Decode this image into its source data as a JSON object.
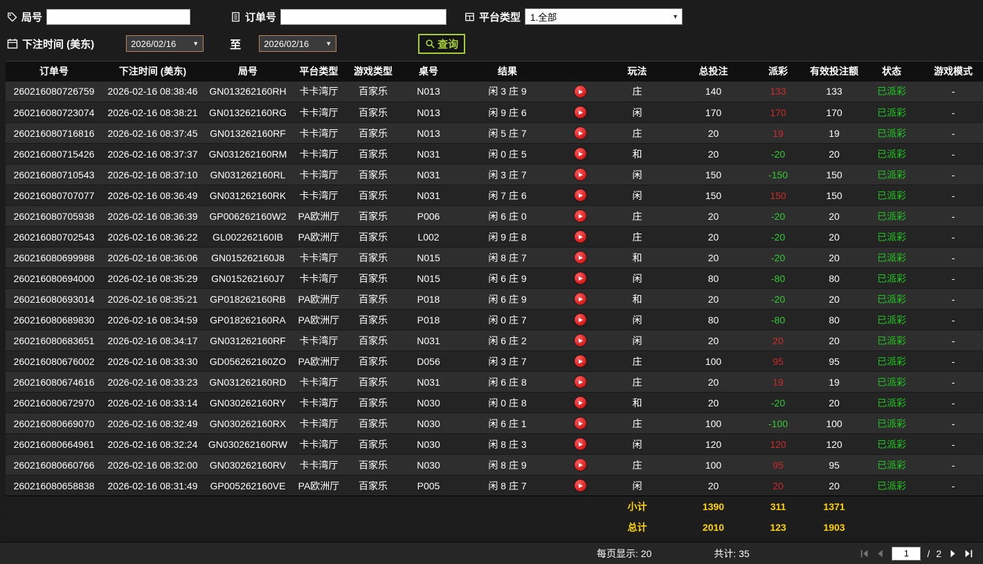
{
  "filters": {
    "game_no_label": "局号",
    "game_no_value": "",
    "order_no_label": "订单号",
    "order_no_value": "",
    "platform_label": "平台类型",
    "platform_value": "1.全部",
    "bet_time_label": "下注时间 (美东)",
    "date_from": "2026/02/16",
    "to_label": "至",
    "date_to": "2026/02/16",
    "query_label": "查询"
  },
  "table": {
    "headers": {
      "order_no": "订单号",
      "bet_time": "下注时间 (美东)",
      "game_no": "局号",
      "platform": "平台类型",
      "game_type": "游戏类型",
      "table_no": "桌号",
      "result": "结果",
      "replay": "",
      "play": "玩法",
      "total_bet": "总投注",
      "payout": "派彩",
      "valid_bet": "有效投注额",
      "status": "状态",
      "mode": "游戏模式"
    },
    "rows": [
      {
        "order_no": "260216080726759",
        "bet_time": "2026-02-16 08:38:46",
        "game_no": "GN013262160RH",
        "platform": "卡卡湾厅",
        "game_type": "百家乐",
        "table_no": "N013",
        "result": "闲 3 庄 9",
        "play": "庄",
        "total_bet": "140",
        "payout": "133",
        "valid_bet": "133",
        "status": "已派彩",
        "mode": "-"
      },
      {
        "order_no": "260216080723074",
        "bet_time": "2026-02-16 08:38:21",
        "game_no": "GN013262160RG",
        "platform": "卡卡湾厅",
        "game_type": "百家乐",
        "table_no": "N013",
        "result": "闲 9 庄 6",
        "play": "闲",
        "total_bet": "170",
        "payout": "170",
        "valid_bet": "170",
        "status": "已派彩",
        "mode": "-"
      },
      {
        "order_no": "260216080716816",
        "bet_time": "2026-02-16 08:37:45",
        "game_no": "GN013262160RF",
        "platform": "卡卡湾厅",
        "game_type": "百家乐",
        "table_no": "N013",
        "result": "闲 5 庄 7",
        "play": "庄",
        "total_bet": "20",
        "payout": "19",
        "valid_bet": "19",
        "status": "已派彩",
        "mode": "-"
      },
      {
        "order_no": "260216080715426",
        "bet_time": "2026-02-16 08:37:37",
        "game_no": "GN031262160RM",
        "platform": "卡卡湾厅",
        "game_type": "百家乐",
        "table_no": "N031",
        "result": "闲 0 庄 5",
        "play": "和",
        "total_bet": "20",
        "payout": "-20",
        "valid_bet": "20",
        "status": "已派彩",
        "mode": "-"
      },
      {
        "order_no": "260216080710543",
        "bet_time": "2026-02-16 08:37:10",
        "game_no": "GN031262160RL",
        "platform": "卡卡湾厅",
        "game_type": "百家乐",
        "table_no": "N031",
        "result": "闲 3 庄 7",
        "play": "闲",
        "total_bet": "150",
        "payout": "-150",
        "valid_bet": "150",
        "status": "已派彩",
        "mode": "-"
      },
      {
        "order_no": "260216080707077",
        "bet_time": "2026-02-16 08:36:49",
        "game_no": "GN031262160RK",
        "platform": "卡卡湾厅",
        "game_type": "百家乐",
        "table_no": "N031",
        "result": "闲 7 庄 6",
        "play": "闲",
        "total_bet": "150",
        "payout": "150",
        "valid_bet": "150",
        "status": "已派彩",
        "mode": "-"
      },
      {
        "order_no": "260216080705938",
        "bet_time": "2026-02-16 08:36:39",
        "game_no": "GP006262160W2",
        "platform": "PA欧洲厅",
        "game_type": "百家乐",
        "table_no": "P006",
        "result": "闲 6 庄 0",
        "play": "庄",
        "total_bet": "20",
        "payout": "-20",
        "valid_bet": "20",
        "status": "已派彩",
        "mode": "-"
      },
      {
        "order_no": "260216080702543",
        "bet_time": "2026-02-16 08:36:22",
        "game_no": "GL002262160IB",
        "platform": "PA欧洲厅",
        "game_type": "百家乐",
        "table_no": "L002",
        "result": "闲 9 庄 8",
        "play": "庄",
        "total_bet": "20",
        "payout": "-20",
        "valid_bet": "20",
        "status": "已派彩",
        "mode": "-"
      },
      {
        "order_no": "260216080699988",
        "bet_time": "2026-02-16 08:36:06",
        "game_no": "GN015262160J8",
        "platform": "卡卡湾厅",
        "game_type": "百家乐",
        "table_no": "N015",
        "result": "闲 8 庄 7",
        "play": "和",
        "total_bet": "20",
        "payout": "-20",
        "valid_bet": "20",
        "status": "已派彩",
        "mode": "-"
      },
      {
        "order_no": "260216080694000",
        "bet_time": "2026-02-16 08:35:29",
        "game_no": "GN015262160J7",
        "platform": "卡卡湾厅",
        "game_type": "百家乐",
        "table_no": "N015",
        "result": "闲 6 庄 9",
        "play": "闲",
        "total_bet": "80",
        "payout": "-80",
        "valid_bet": "80",
        "status": "已派彩",
        "mode": "-"
      },
      {
        "order_no": "260216080693014",
        "bet_time": "2026-02-16 08:35:21",
        "game_no": "GP018262160RB",
        "platform": "PA欧洲厅",
        "game_type": "百家乐",
        "table_no": "P018",
        "result": "闲 6 庄 9",
        "play": "和",
        "total_bet": "20",
        "payout": "-20",
        "valid_bet": "20",
        "status": "已派彩",
        "mode": "-"
      },
      {
        "order_no": "260216080689830",
        "bet_time": "2026-02-16 08:34:59",
        "game_no": "GP018262160RA",
        "platform": "PA欧洲厅",
        "game_type": "百家乐",
        "table_no": "P018",
        "result": "闲 0 庄 7",
        "play": "闲",
        "total_bet": "80",
        "payout": "-80",
        "valid_bet": "80",
        "status": "已派彩",
        "mode": "-"
      },
      {
        "order_no": "260216080683651",
        "bet_time": "2026-02-16 08:34:17",
        "game_no": "GN031262160RF",
        "platform": "卡卡湾厅",
        "game_type": "百家乐",
        "table_no": "N031",
        "result": "闲 6 庄 2",
        "play": "闲",
        "total_bet": "20",
        "payout": "20",
        "valid_bet": "20",
        "status": "已派彩",
        "mode": "-"
      },
      {
        "order_no": "260216080676002",
        "bet_time": "2026-02-16 08:33:30",
        "game_no": "GD056262160ZO",
        "platform": "PA欧洲厅",
        "game_type": "百家乐",
        "table_no": "D056",
        "result": "闲 3 庄 7",
        "play": "庄",
        "total_bet": "100",
        "payout": "95",
        "valid_bet": "95",
        "status": "已派彩",
        "mode": "-"
      },
      {
        "order_no": "260216080674616",
        "bet_time": "2026-02-16 08:33:23",
        "game_no": "GN031262160RD",
        "platform": "卡卡湾厅",
        "game_type": "百家乐",
        "table_no": "N031",
        "result": "闲 6 庄 8",
        "play": "庄",
        "total_bet": "20",
        "payout": "19",
        "valid_bet": "19",
        "status": "已派彩",
        "mode": "-"
      },
      {
        "order_no": "260216080672970",
        "bet_time": "2026-02-16 08:33:14",
        "game_no": "GN030262160RY",
        "platform": "卡卡湾厅",
        "game_type": "百家乐",
        "table_no": "N030",
        "result": "闲 0 庄 8",
        "play": "和",
        "total_bet": "20",
        "payout": "-20",
        "valid_bet": "20",
        "status": "已派彩",
        "mode": "-"
      },
      {
        "order_no": "260216080669070",
        "bet_time": "2026-02-16 08:32:49",
        "game_no": "GN030262160RX",
        "platform": "卡卡湾厅",
        "game_type": "百家乐",
        "table_no": "N030",
        "result": "闲 6 庄 1",
        "play": "庄",
        "total_bet": "100",
        "payout": "-100",
        "valid_bet": "100",
        "status": "已派彩",
        "mode": "-"
      },
      {
        "order_no": "260216080664961",
        "bet_time": "2026-02-16 08:32:24",
        "game_no": "GN030262160RW",
        "platform": "卡卡湾厅",
        "game_type": "百家乐",
        "table_no": "N030",
        "result": "闲 8 庄 3",
        "play": "闲",
        "total_bet": "120",
        "payout": "120",
        "valid_bet": "120",
        "status": "已派彩",
        "mode": "-"
      },
      {
        "order_no": "260216080660766",
        "bet_time": "2026-02-16 08:32:00",
        "game_no": "GN030262160RV",
        "platform": "卡卡湾厅",
        "game_type": "百家乐",
        "table_no": "N030",
        "result": "闲 8 庄 9",
        "play": "庄",
        "total_bet": "100",
        "payout": "95",
        "valid_bet": "95",
        "status": "已派彩",
        "mode": "-"
      },
      {
        "order_no": "260216080658838",
        "bet_time": "2026-02-16 08:31:49",
        "game_no": "GP005262160VE",
        "platform": "PA欧洲厅",
        "game_type": "百家乐",
        "table_no": "P005",
        "result": "闲 8 庄 7",
        "play": "闲",
        "total_bet": "20",
        "payout": "20",
        "valid_bet": "20",
        "status": "已派彩",
        "mode": "-"
      }
    ]
  },
  "totals": {
    "subtotal_label": "小计",
    "subtotal_total_bet": "1390",
    "subtotal_payout": "311",
    "subtotal_valid_bet": "1371",
    "total_label": "总计",
    "total_total_bet": "2010",
    "total_payout": "123",
    "total_valid_bet": "1903"
  },
  "pagination": {
    "per_page": "每页显示: 20",
    "total_count": "共计: 35",
    "current_page": "1",
    "divider": "/",
    "total_pages": "2"
  },
  "colors": {
    "payout_positive": "#cc2a2a",
    "payout_negative": "#33cc33",
    "status_paid": "#1ecb1e",
    "totals_yellow": "#ffd400",
    "accent_green": "#a6ce39"
  }
}
